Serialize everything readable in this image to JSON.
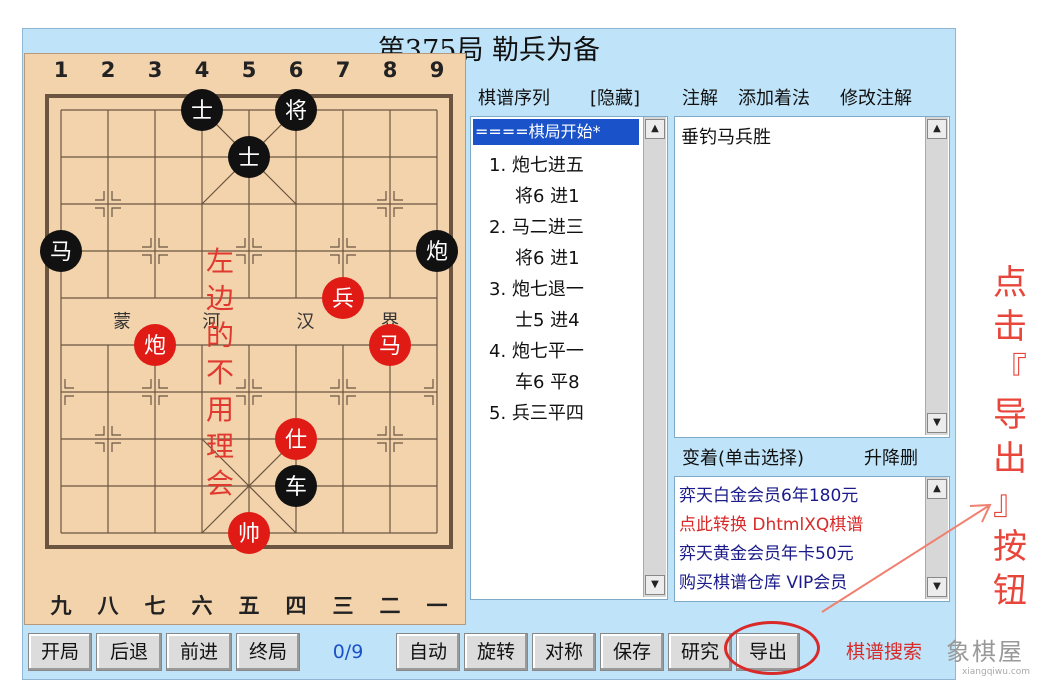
{
  "title": "第375局 勒兵为备",
  "board": {
    "top_numbers": [
      "1",
      "2",
      "3",
      "4",
      "5",
      "6",
      "7",
      "8",
      "9"
    ],
    "bottom_numbers": [
      "九",
      "八",
      "七",
      "六",
      "五",
      "四",
      "三",
      "二",
      "一"
    ],
    "river_labels": [
      "蒙",
      "河",
      "汉",
      "界"
    ],
    "pieces": [
      {
        "label": "士",
        "side": "black",
        "col": 3,
        "row": 0
      },
      {
        "label": "将",
        "side": "black",
        "col": 5,
        "row": 0
      },
      {
        "label": "士",
        "side": "black",
        "col": 4,
        "row": 1
      },
      {
        "label": "马",
        "side": "black",
        "col": 0,
        "row": 3
      },
      {
        "label": "炮",
        "side": "black",
        "col": 8,
        "row": 3
      },
      {
        "label": "兵",
        "side": "red",
        "col": 6,
        "row": 4
      },
      {
        "label": "炮",
        "side": "red",
        "col": 2,
        "row": 5
      },
      {
        "label": "马",
        "side": "red",
        "col": 7,
        "row": 5
      },
      {
        "label": "仕",
        "side": "red",
        "col": 5,
        "row": 7
      },
      {
        "label": "车",
        "side": "black",
        "col": 5,
        "row": 8
      },
      {
        "label": "帅",
        "side": "red",
        "col": 4,
        "row": 9
      }
    ]
  },
  "annotation_left": [
    "左",
    "边",
    "的",
    "不",
    "用",
    "理",
    "会"
  ],
  "moves_panel": {
    "header": "棋谱序列",
    "hide_label": "[隐藏]",
    "selected": "====棋局开始*",
    "lines": [
      "1. 炮七进五",
      "将6 进1",
      "2. 马二进三",
      "将6 进1",
      "3. 炮七退一",
      "士5 进4",
      "4. 炮七平一",
      "车6 平8",
      "5. 兵三平四"
    ]
  },
  "comment_panel": {
    "tabs": [
      "注解",
      "添加着法",
      "修改注解"
    ],
    "text": "垂钓马兵胜"
  },
  "variation_panel": {
    "header": "变着(单击选择)",
    "action": "升降删",
    "items": [
      {
        "text": "弈天白金会员6年180元",
        "red": false
      },
      {
        "text": "点此转换 DhtmlXQ棋谱",
        "red": true
      },
      {
        "text": "弈天黄金会员年卡50元",
        "red": false
      },
      {
        "text": "购买棋谱仓库 VIP会员",
        "red": false
      }
    ]
  },
  "toolbar": {
    "buttons": [
      "开局",
      "后退",
      "前进",
      "终局"
    ],
    "progress": "0/9",
    "buttons2": [
      "自动",
      "旋转",
      "对称",
      "保存",
      "研究",
      "导出"
    ],
    "search_label": "棋谱搜索"
  },
  "side_note": [
    "点",
    "击",
    "『",
    "导",
    "出",
    "』",
    "按",
    "钮"
  ],
  "watermark": "象棋屋",
  "watermark_sub": "xiangqiwu.com",
  "colors": {
    "bg": "#bfe3f8",
    "board": "#f3d3ac",
    "red_piece": "#e01a14",
    "black_piece": "#111111",
    "accent": "#e8463a"
  }
}
